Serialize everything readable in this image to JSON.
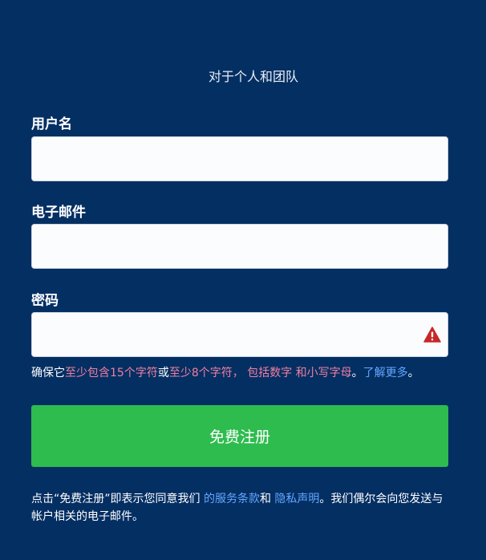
{
  "header": {
    "subtitle": "对于个人和团队"
  },
  "form": {
    "username": {
      "label": "用户名",
      "value": "",
      "placeholder": ""
    },
    "email": {
      "label": "电子邮件",
      "value": "",
      "placeholder": ""
    },
    "password": {
      "label": "密码",
      "value": "",
      "placeholder": "",
      "status_icon": "warning-icon"
    },
    "hint": {
      "prefix": "确保它",
      "req1": "至少包含15个字符",
      "or": "或",
      "req2": "至少8个字符，",
      "req3": " 包括数字",
      "req4": " 和小写字母",
      "period": "。",
      "learn_more": "了解更多",
      "end": "。"
    },
    "submit_label": "免费注册"
  },
  "terms": {
    "prefix": "点击“免费注册”即表示您同意我们 ",
    "tos_link": "的服务条款",
    "and": "和 ",
    "privacy_link": "隐私声明",
    "suffix": "。我们偶尔会向您发送与帐户相关的电子邮件。"
  },
  "colors": {
    "background": "#042f63",
    "accent_green": "#2ebc4f",
    "link_blue": "#63a7ff",
    "warning_pink": "#f07fa0",
    "warning_red": "#c62828"
  }
}
